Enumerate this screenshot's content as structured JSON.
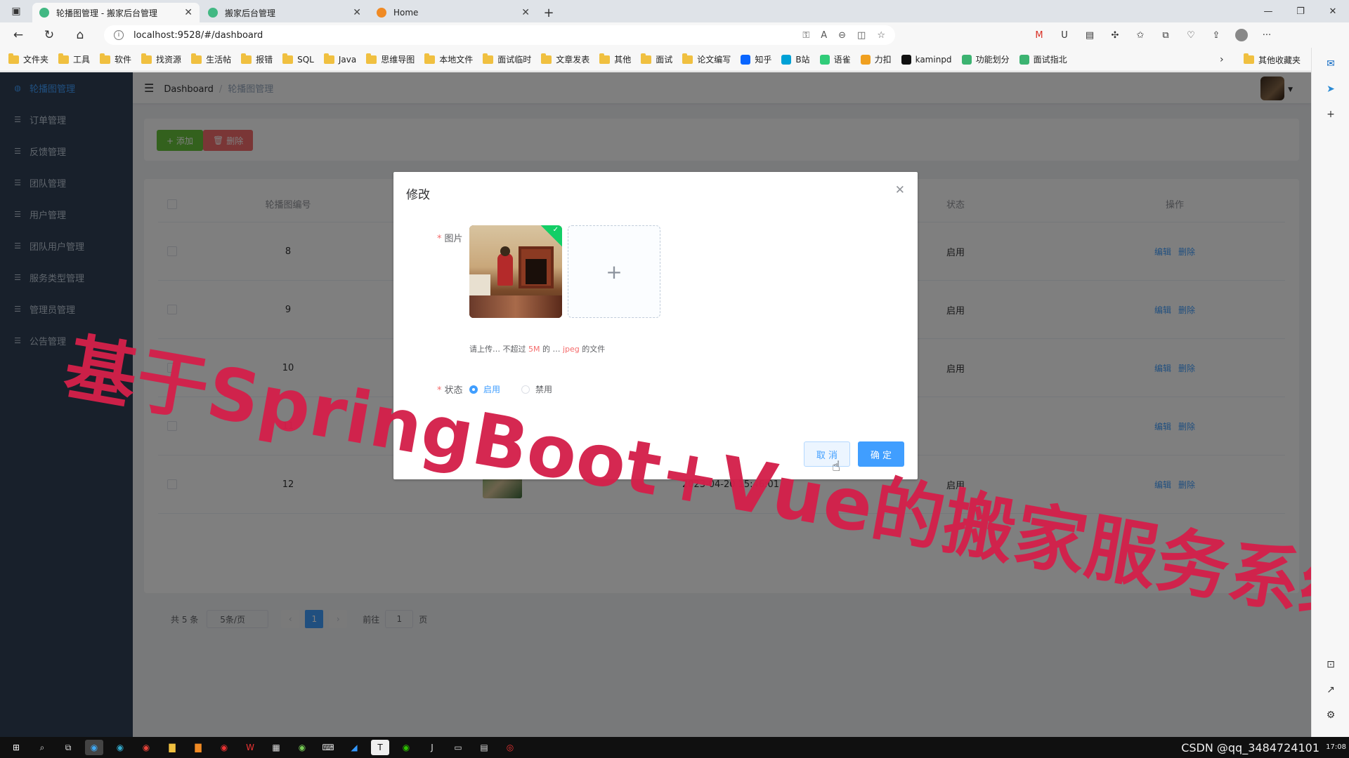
{
  "browser": {
    "tabs": [
      {
        "title": "轮播图管理 - 搬家后台管理",
        "icon": "vue-logo-icon",
        "active": true
      },
      {
        "title": "搬家后台管理",
        "icon": "vue-logo-icon",
        "active": false
      },
      {
        "title": "Home",
        "icon": "home-favicon",
        "active": false
      }
    ],
    "url": "localhost:9528/#/dashboard",
    "bookmarks": [
      "文件夹",
      "工具",
      "软件",
      "找资源",
      "生活帖",
      "报错",
      "SQL",
      "Java",
      "思维导图",
      "本地文件",
      "面试临时",
      "文章发表",
      "其他",
      "面试",
      "论文编写",
      "知乎",
      "B站",
      "语雀",
      "力扣",
      "kaminpd",
      "功能划分",
      "面试指北"
    ],
    "other_bookmarks": "其他收藏夹"
  },
  "sidebar": {
    "items": [
      {
        "label": "轮播图管理",
        "active": true
      },
      {
        "label": "订单管理",
        "active": false
      },
      {
        "label": "反馈管理",
        "active": false
      },
      {
        "label": "团队管理",
        "active": false
      },
      {
        "label": "用户管理",
        "active": false
      },
      {
        "label": "团队用户管理",
        "active": false
      },
      {
        "label": "服务类型管理",
        "active": false
      },
      {
        "label": "管理员管理",
        "active": false
      },
      {
        "label": "公告管理",
        "active": false
      }
    ]
  },
  "navbar": {
    "breadcrumb_home": "Dashboard",
    "breadcrumb_current": "轮播图管理"
  },
  "toolbar": {
    "add_label": "+ 添加",
    "delete_label": "删除"
  },
  "table": {
    "headers": {
      "id": "轮播图编号",
      "status": "状态",
      "ops": "操作"
    },
    "rows": [
      {
        "id": "8",
        "time": "",
        "status": "启用"
      },
      {
        "id": "9",
        "time": "",
        "status": "启用"
      },
      {
        "id": "10",
        "time": "",
        "status": "启用"
      },
      {
        "id": "11",
        "time": "",
        "status": ""
      },
      {
        "id": "12",
        "time": "2023-04-20 15:46:01",
        "status": "启用"
      }
    ],
    "edit_label": "编辑",
    "delete_label": "删除"
  },
  "pager": {
    "total": "共 5 条",
    "size": "5条/页",
    "current": "1",
    "goto_prefix": "前往",
    "goto_value": "1",
    "goto_suffix": "页"
  },
  "dialog": {
    "title": "修改",
    "image_label": "图片",
    "tip": {
      "p1": "请上传",
      "p2": "不超过",
      "size": "5M",
      "p3": "的",
      "fmt": "jpeg",
      "p4": "的文件"
    },
    "status_label": "状态",
    "radio_on": "启用",
    "radio_off": "禁用",
    "cancel": "取 消",
    "confirm": "确 定"
  },
  "watermark": "基于SpringBoot+Vue的搬家服务系统",
  "taskbar": {
    "csdn": "CSDN @qq_3484724101",
    "time": "17:08"
  }
}
